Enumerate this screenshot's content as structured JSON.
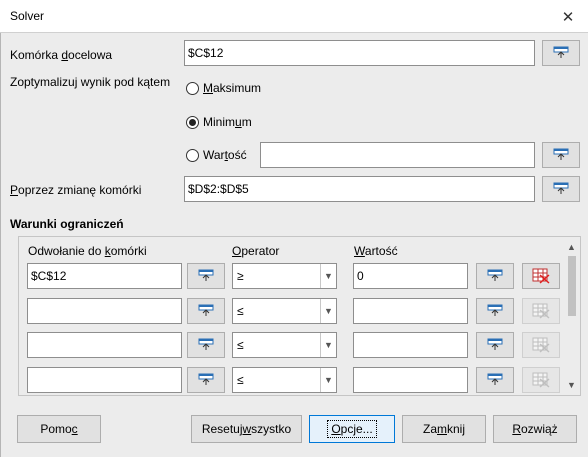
{
  "window": {
    "title": "Solver"
  },
  "target_cell": {
    "label_pre": "Komórka ",
    "label_u": "d",
    "label_post": "ocelowa",
    "value": "$C$12"
  },
  "optimize": {
    "label": "Zoptymalizuj wynik pod kątem",
    "maximum": {
      "pre": "",
      "u": "M",
      "post": "aksimum"
    },
    "minimum": {
      "pre": "Minim",
      "u": "u",
      "post": "m"
    },
    "value_option": {
      "pre": "War",
      "u": "t",
      "post": "ość"
    },
    "value_field": "",
    "selected": "minimum"
  },
  "changing_cells": {
    "label_pre": "",
    "label_u": "P",
    "label_post": "oprzez zmianę komórki",
    "value": "$D$2:$D$5"
  },
  "constraints": {
    "title": "Warunki ograniczeń",
    "headers": {
      "ref": {
        "pre": "Odwołanie do ",
        "u": "k",
        "post": "omórki"
      },
      "op": {
        "pre": "",
        "u": "O",
        "post": "perator"
      },
      "val": {
        "pre": "",
        "u": "W",
        "post": "artość"
      }
    },
    "rows": [
      {
        "ref": "$C$12",
        "op": "≥",
        "value": "0"
      },
      {
        "ref": "",
        "op": "≤",
        "value": ""
      },
      {
        "ref": "",
        "op": "≤",
        "value": ""
      },
      {
        "ref": "",
        "op": "≤",
        "value": ""
      }
    ]
  },
  "buttons": {
    "help": {
      "pre": "Pomo",
      "u": "c",
      "post": ""
    },
    "reset": {
      "pre": "Resetuj ",
      "u": "w",
      "post": "szystko"
    },
    "options": {
      "pre": "",
      "u": "O",
      "post": "pcje..."
    },
    "close": {
      "pre": "Za",
      "u": "m",
      "post": "knij"
    },
    "solve": {
      "pre": "",
      "u": "R",
      "post": "ozwiąż"
    }
  },
  "icons": {
    "close": "close-icon",
    "shrink": "shrink-icon",
    "delete": "delete-row-icon",
    "dropdown": "chevron-down-icon"
  },
  "colors": {
    "accent": "#0078d7",
    "delete_red": "#e02020",
    "background": "#ececec"
  }
}
